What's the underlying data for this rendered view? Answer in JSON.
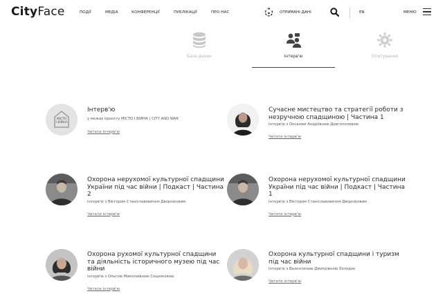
{
  "header": {
    "logo_bold": "City",
    "logo_light": "Face",
    "nav": [
      "ПОДІЇ",
      "МЕДІА",
      "КОНФЕРЕНЦІЇ",
      "ПУБЛІКАЦІЇ",
      "ПРО НАС"
    ],
    "received_label": "ОТРИМАНІ ДАНІ",
    "lang": "EN",
    "menu_label": "МЕНЮ"
  },
  "tabs": [
    {
      "label": "База даних",
      "icon": "database-icon",
      "active": false
    },
    {
      "label": "Інтерв'ю",
      "icon": "interview-icon",
      "active": true
    },
    {
      "label": "Опитування",
      "icon": "gear-icon",
      "active": false
    }
  ],
  "cards": [
    {
      "title": "Інтерв'ю",
      "subtitle": "у межах проєкту МІСТО І ВІЙНА | CITY AND WAR",
      "link": "Читати інтерв'ю",
      "avatar_logo_line1": "МІСТО",
      "avatar_logo_line2": "І ВІЙНА"
    },
    {
      "title": "Сучасне мистецтво та стратегії роботи з незручною спадщиною | Частина 1",
      "subtitle": "Інтерв'ю з Оксаною Андріївною Довгополовою",
      "link": "Читати інтерв'ю"
    },
    {
      "title": "Охорона нерухомої культурної спадщини України під час війни | Подкаст | Частина 2",
      "subtitle": "Інтерв'ю з Віктором Станіславовичем Дворніковим",
      "link": "Читати інтерв'ю"
    },
    {
      "title": "Охорона нерухомої культурної спадщини України під час війни | Подкаст | Частина 1",
      "subtitle": "Інтерв'ю з Віктором Станіславовичем Дворніковим",
      "link": "Читати інтерв'ю"
    },
    {
      "title": "Охорона рухомої культурної спадщини та діяльність історичного музею під час війни",
      "subtitle": "Інтерв'ю з Ольгою Миколаївною Сощніковою",
      "link": "Читати інтерв'ю"
    },
    {
      "title": "Охорона культурної спадщини і туризм під час війни",
      "subtitle": "Інтерв'ю з Валентиною Дмитрівною Холодок",
      "link": "Читати інтерв'ю"
    }
  ]
}
